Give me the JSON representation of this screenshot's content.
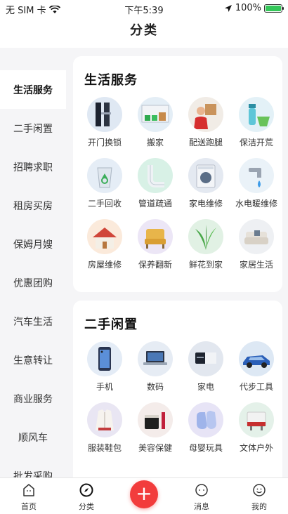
{
  "status_bar": {
    "carrier": "无 SIM 卡",
    "time": "下午5:39",
    "battery": "100%",
    "battery_level": 1.0
  },
  "header": {
    "title": "分类"
  },
  "sidebar": {
    "items": [
      {
        "label": "生活服务",
        "active": true
      },
      {
        "label": "二手闲置"
      },
      {
        "label": "招聘求职"
      },
      {
        "label": "租房买房"
      },
      {
        "label": "保姆月嫂"
      },
      {
        "label": "优惠团购"
      },
      {
        "label": "汽车生活"
      },
      {
        "label": "生意转让"
      },
      {
        "label": "商业服务"
      },
      {
        "label": "顺风车"
      },
      {
        "label": "批发采购"
      }
    ]
  },
  "sections": [
    {
      "title": "生活服务",
      "items": [
        {
          "label": "开门换锁",
          "icon": "door-lock-icon"
        },
        {
          "label": "搬家",
          "icon": "moving-truck-icon"
        },
        {
          "label": "配送跑腿",
          "icon": "delivery-courier-icon"
        },
        {
          "label": "保洁开荒",
          "icon": "cleaning-supplies-icon"
        },
        {
          "label": "二手回收",
          "icon": "recycle-bin-icon"
        },
        {
          "label": "管道疏通",
          "icon": "pipe-icon"
        },
        {
          "label": "家电维修",
          "icon": "washing-machine-icon"
        },
        {
          "label": "水电暖维修",
          "icon": "water-faucet-icon"
        },
        {
          "label": "房屋维修",
          "icon": "house-icon"
        },
        {
          "label": "保养翻新",
          "icon": "armchair-icon"
        },
        {
          "label": "鲜花到家",
          "icon": "plant-icon"
        },
        {
          "label": "家居生活",
          "icon": "sofa-icon"
        }
      ]
    },
    {
      "title": "二手闲置",
      "items": [
        {
          "label": "手机",
          "icon": "smartphone-icon"
        },
        {
          "label": "数码",
          "icon": "laptop-icon"
        },
        {
          "label": "家电",
          "icon": "appliance-icon"
        },
        {
          "label": "代步工具",
          "icon": "car-icon"
        },
        {
          "label": "服装鞋包",
          "icon": "jacket-icon"
        },
        {
          "label": "美容保健",
          "icon": "cosmetics-icon"
        },
        {
          "label": "母婴玩具",
          "icon": "baby-shoes-icon"
        },
        {
          "label": "文体户外",
          "icon": "sports-icon"
        }
      ]
    }
  ],
  "tab_bar": {
    "tabs": [
      {
        "label": "首页",
        "icon": "home-icon"
      },
      {
        "label": "分类",
        "icon": "compass-icon"
      },
      {
        "label": "",
        "icon": "plus-icon"
      },
      {
        "label": "消息",
        "icon": "message-icon"
      },
      {
        "label": "我的",
        "icon": "profile-icon"
      }
    ]
  }
}
